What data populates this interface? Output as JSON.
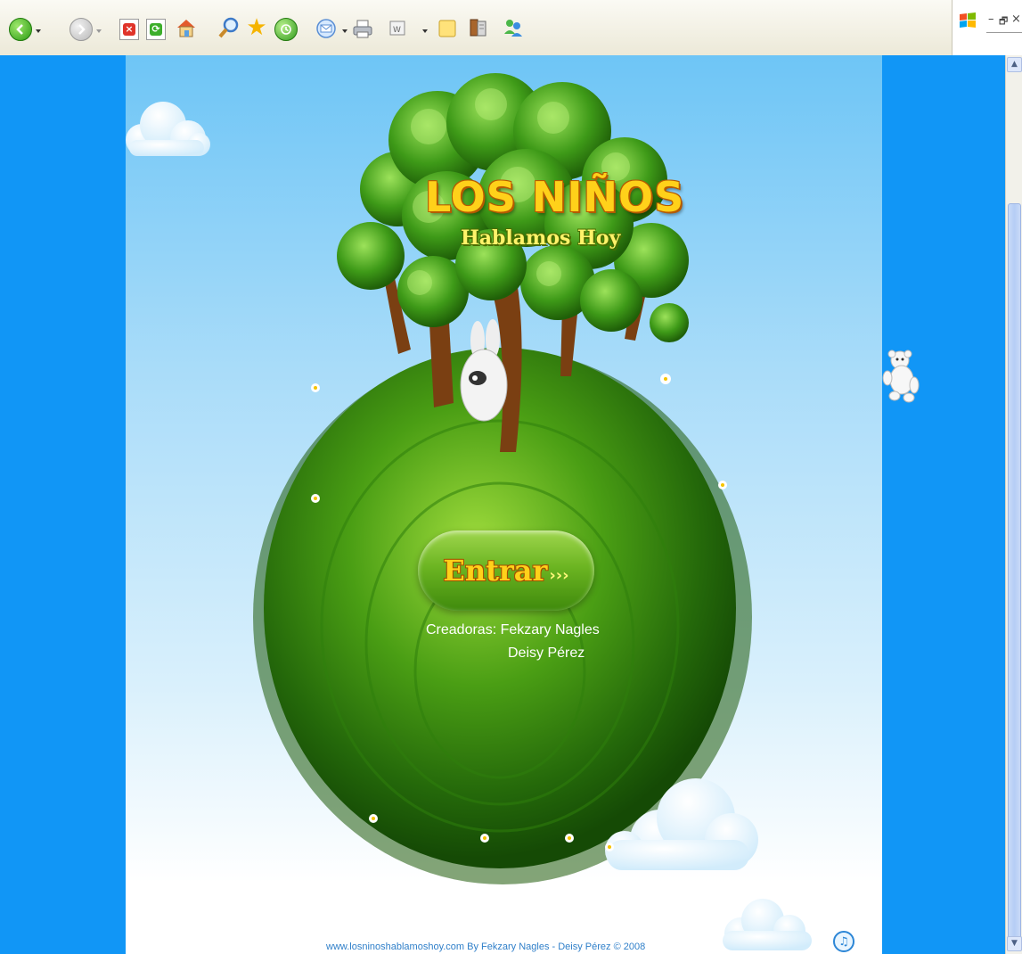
{
  "browser": {
    "toolbar": {
      "icons": [
        "back-icon",
        "forward-icon",
        "stop-icon",
        "refresh-icon",
        "home-icon",
        "search-icon",
        "favorites-icon",
        "history-icon",
        "mail-icon",
        "print-icon",
        "edit-icon",
        "folder-icon",
        "book-icon",
        "messenger-icon"
      ]
    },
    "window_controls": {
      "minimize": "–",
      "restore": "🗗",
      "close": "×"
    }
  },
  "site": {
    "logo": {
      "title": "LOS NIÑOS",
      "subtitle": "Hablamos Hoy"
    },
    "enter_button": {
      "label": "Entrar",
      "arrows": "›››"
    },
    "credits": {
      "line1": "Creadoras: Fekzary Nagles",
      "line2": "Deisy Pérez"
    },
    "footer": "www.losninoshablamoshoy.com By  Fekzary Nagles - Deisy Pérez  © 2008",
    "music_icon": "♫"
  },
  "colors": {
    "page_blue": "#1196f6",
    "sky_top": "#6ec5f6",
    "grass": "#3f8a0c",
    "logo_yellow": "#ffd11a",
    "footer_text": "#2f7fc9"
  }
}
